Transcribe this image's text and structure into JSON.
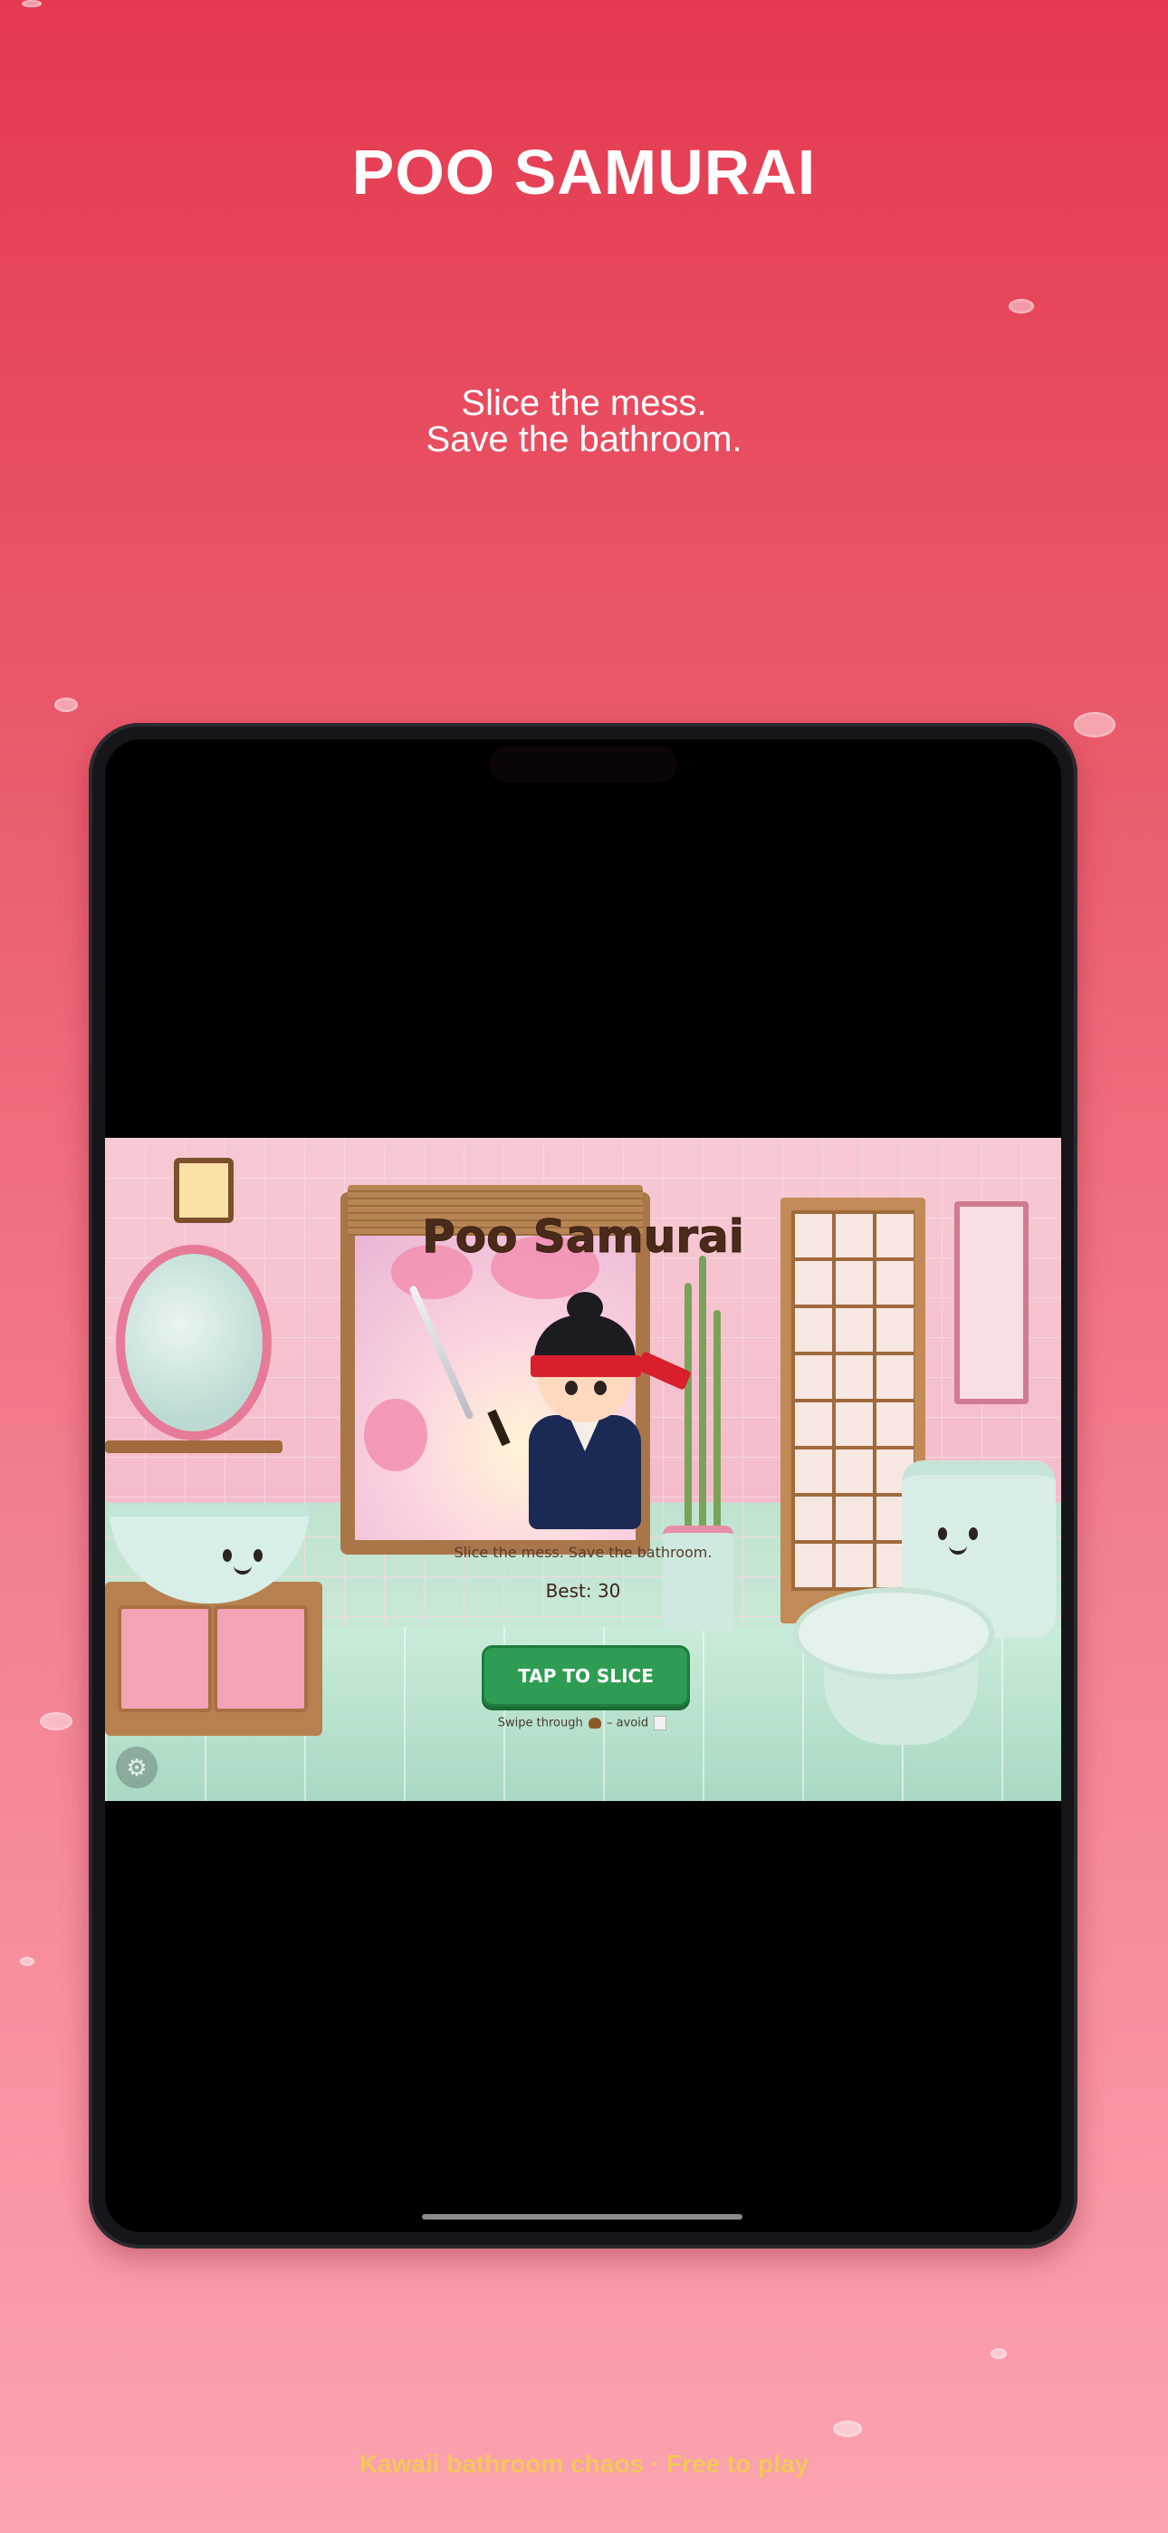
{
  "promo": {
    "title": "POO SAMURAI",
    "subtitle_line1": "Slice the mess.",
    "subtitle_line2": "Save the bathroom.",
    "footer": "Kawaii bathroom chaos · Free to play"
  },
  "game": {
    "title": "Poo Samurai",
    "subtitle": "Slice the mess. Save the bathroom.",
    "best_label": "Best: 30",
    "tap_button": "TAP TO SLICE",
    "hint_prefix": "Swipe through",
    "hint_middle": "– avoid",
    "settings_icon": "gear-icon"
  },
  "colors": {
    "background_top": "#e5394f",
    "background_bottom": "#fba3b0",
    "button_green": "#2e9d53",
    "footer_yellow": "#f3c75b"
  }
}
